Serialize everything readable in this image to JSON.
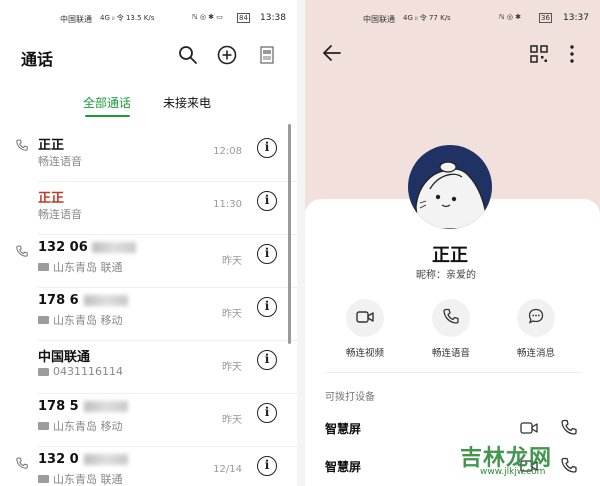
{
  "left": {
    "status": {
      "carrier": "中国联通",
      "signal": "4G ᵢₗ 令 13.5 K/s",
      "icons": "ℕ ◎ ✱ ▭",
      "battery": "84",
      "time": "13:38"
    },
    "title": "通话",
    "tabs": [
      {
        "label": "全部通话"
      },
      {
        "label": "未接来电"
      }
    ],
    "calls": [
      {
        "name": "正正",
        "sub": "畅连语音",
        "time": "12:08",
        "missed": false,
        "phone_icon": true,
        "sim": false
      },
      {
        "name": "正正",
        "sub": "畅连语音",
        "time": "11:30",
        "missed": true,
        "phone_icon": false,
        "sim": false
      },
      {
        "name": "132 06",
        "sub": "山东青岛 联通",
        "time": "昨天",
        "missed": false,
        "phone_icon": true,
        "sim": true
      },
      {
        "name": "178 6",
        "sub": "山东青岛 移动",
        "time": "昨天",
        "missed": false,
        "phone_icon": false,
        "sim": true
      },
      {
        "name": "中国联通",
        "sub": "0431116114",
        "time": "昨天",
        "missed": false,
        "phone_icon": false,
        "sim": true
      },
      {
        "name": "178 5",
        "sub": "山东青岛 移动",
        "time": "昨天",
        "missed": false,
        "phone_icon": false,
        "sim": true
      },
      {
        "name": "132 0",
        "sub": "山东青岛 联通",
        "time": "12/14",
        "missed": false,
        "phone_icon": true,
        "sim": true
      }
    ]
  },
  "right": {
    "status": {
      "carrier": "中国联通",
      "signal": "4G ᵢₗ 令 77 K/s",
      "icons": "ℕ ◎ ✱",
      "battery": "36",
      "time": "13:37"
    },
    "contact": {
      "name": "正正",
      "nickname": "昵称：亲爱的"
    },
    "actions": [
      {
        "label": "畅连视频",
        "icon": "video-call-icon"
      },
      {
        "label": "畅连语音",
        "icon": "voice-call-icon"
      },
      {
        "label": "畅连消息",
        "icon": "message-icon"
      }
    ],
    "section_title": "可拨打设备",
    "devices": [
      {
        "label": "智慧屏"
      },
      {
        "label": "智慧屏"
      }
    ],
    "watermark": {
      "text": "吉林龙网",
      "url": "www.jlkjw.com"
    }
  }
}
